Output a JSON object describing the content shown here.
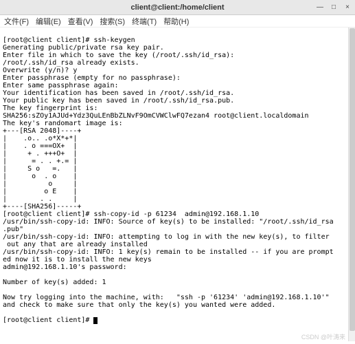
{
  "titlebar": {
    "title": "client@client:/home/client"
  },
  "win": {
    "min": "—",
    "max": "□",
    "close": "×"
  },
  "menu": {
    "file": "文件(F)",
    "edit": "编辑(E)",
    "view": "查看(V)",
    "search": "搜索(S)",
    "terminal": "终端(T)",
    "help": "帮助(H)"
  },
  "term": {
    "l01": "[root@client client]# ssh-keygen",
    "l02": "Generating public/private rsa key pair.",
    "l03": "Enter file in which to save the key (/root/.ssh/id_rsa):",
    "l04": "/root/.ssh/id_rsa already exists.",
    "l05": "Overwrite (y/n)? y",
    "l06": "Enter passphrase (empty for no passphrase):",
    "l07": "Enter same passphrase again:",
    "l08": "Your identification has been saved in /root/.ssh/id_rsa.",
    "l09": "Your public key has been saved in /root/.ssh/id_rsa.pub.",
    "l10": "The key fingerprint is:",
    "l11": "SHA256:sZOy1AJUd+Ydz3QuLEnBbZLNvF9OmCVWClwFQ7ezan4 root@client.localdomain",
    "l12": "The key's randomart image is:",
    "l13": "+---[RSA 2048]----+",
    "l14": "|    .o.. .o*X*+*|",
    "l15": "|    . o ===OX+  |",
    "l16": "|     + . +++O+  |",
    "l17": "|      = . . +.= |",
    "l18": "|     S o   =.   |",
    "l19": "|      o  . o    |",
    "l20": "|          o     |",
    "l21": "|         o E    |",
    "l22": "|        . .     |",
    "l23": "+----[SHA256]-----+",
    "l24": "[root@client client]# ssh-copy-id -p 61234  admin@192.168.1.10",
    "l25": "/usr/bin/ssh-copy-id: INFO: Source of key(s) to be installed: \"/root/.ssh/id_rsa",
    "l26": ".pub\"",
    "l27": "/usr/bin/ssh-copy-id: INFO: attempting to log in with the new key(s), to filter",
    "l28": " out any that are already installed",
    "l29": "/usr/bin/ssh-copy-id: INFO: 1 key(s) remain to be installed -- if you are prompt",
    "l30": "ed now it is to install the new keys",
    "l31": "admin@192.168.1.10's password:",
    "l32": "",
    "l33": "Number of key(s) added: 1",
    "l34": "",
    "l35": "Now try logging into the machine, with:   \"ssh -p '61234' 'admin@192.168.1.10'\"",
    "l36": "and check to make sure that only the key(s) you wanted were added.",
    "l37": "",
    "l38": "[root@client client]# "
  },
  "watermark": "CSDN @叶涛来"
}
